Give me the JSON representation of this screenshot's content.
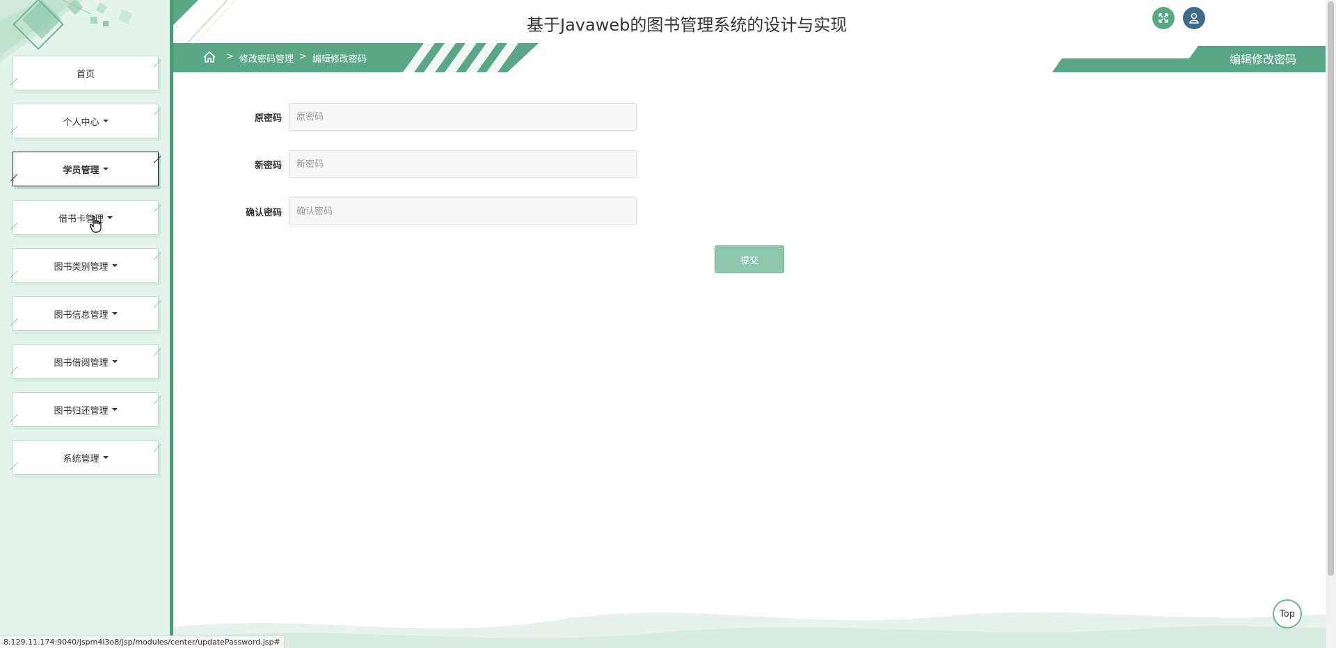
{
  "header": {
    "title": "基于Javaweb的图书管理系统的设计与实现"
  },
  "breadcrumb": {
    "items": [
      "修改密码管理",
      "编辑修改密码"
    ],
    "separator": ">"
  },
  "page_heading": "编辑修改密码",
  "sidebar": {
    "items": [
      {
        "label": "首页",
        "has_caret": false
      },
      {
        "label": "个人中心",
        "has_caret": true
      },
      {
        "label": "学员管理",
        "has_caret": true
      },
      {
        "label": "借书卡管理",
        "has_caret": true
      },
      {
        "label": "图书类别管理",
        "has_caret": true
      },
      {
        "label": "图书信息管理",
        "has_caret": true
      },
      {
        "label": "图书借阅管理",
        "has_caret": true
      },
      {
        "label": "图书归还管理",
        "has_caret": true
      },
      {
        "label": "系统管理",
        "has_caret": true
      }
    ]
  },
  "form": {
    "fields": [
      {
        "label": "原密码",
        "placeholder": "原密码",
        "value": ""
      },
      {
        "label": "新密码",
        "placeholder": "新密码",
        "value": ""
      },
      {
        "label": "确认密码",
        "placeholder": "确认密码",
        "value": ""
      }
    ],
    "submit_label": "提交"
  },
  "top_button_label": "Top",
  "status_url": "8.129.11.174:9040/jspm4l3o8/jsp/modules/center/updatePassword.jsp#",
  "icons": {
    "fullscreen": "expand-icon",
    "user": "user-icon",
    "home": "home-icon"
  },
  "colors": {
    "primary": "#5aa787",
    "sidebar_bg": "#e3f4ec",
    "user_button": "#3e6b8c",
    "submit": "#8cc7ad"
  }
}
